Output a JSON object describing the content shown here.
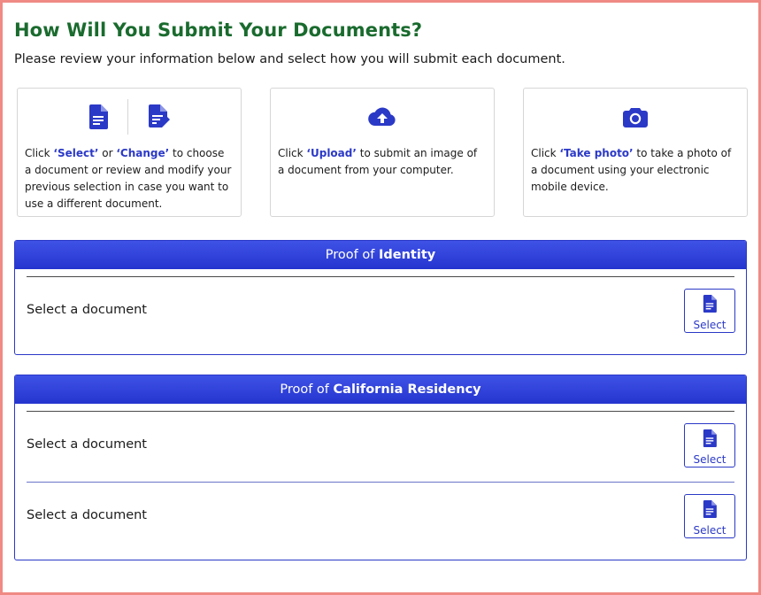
{
  "header": {
    "title": "How Will You Submit Your Documents?",
    "subtitle": "Please review your information below and select how you will submit each document."
  },
  "cards": [
    {
      "icons": [
        "document-icon",
        "document-edit-icon"
      ],
      "pre": "Click ",
      "key1": "‘Select’",
      "mid": " or ",
      "key2": "‘Change’",
      "post": " to choose a document or review and modify your previous selection in case you want to use a different document."
    },
    {
      "icons": [
        "cloud-upload-icon"
      ],
      "pre": "Click ",
      "key1": "‘Upload’",
      "post": " to submit an image of a document from your computer."
    },
    {
      "icons": [
        "camera-icon"
      ],
      "pre": "Click ",
      "key1": "‘Take photo’",
      "post": " to take a photo of a document using your electronic mobile device."
    }
  ],
  "sections": [
    {
      "title_prefix": "Proof of ",
      "title_bold": "Identity",
      "rows": [
        {
          "label": "Select a document",
          "button": "Select"
        }
      ]
    },
    {
      "title_prefix": "Proof of ",
      "title_bold": "California Residency",
      "rows": [
        {
          "label": "Select a document",
          "button": "Select"
        },
        {
          "label": "Select a document",
          "button": "Select"
        }
      ]
    }
  ],
  "colors": {
    "title_green": "#1a6b2e",
    "accent_blue": "#2b39c7",
    "frame_pink": "#f08a84"
  }
}
